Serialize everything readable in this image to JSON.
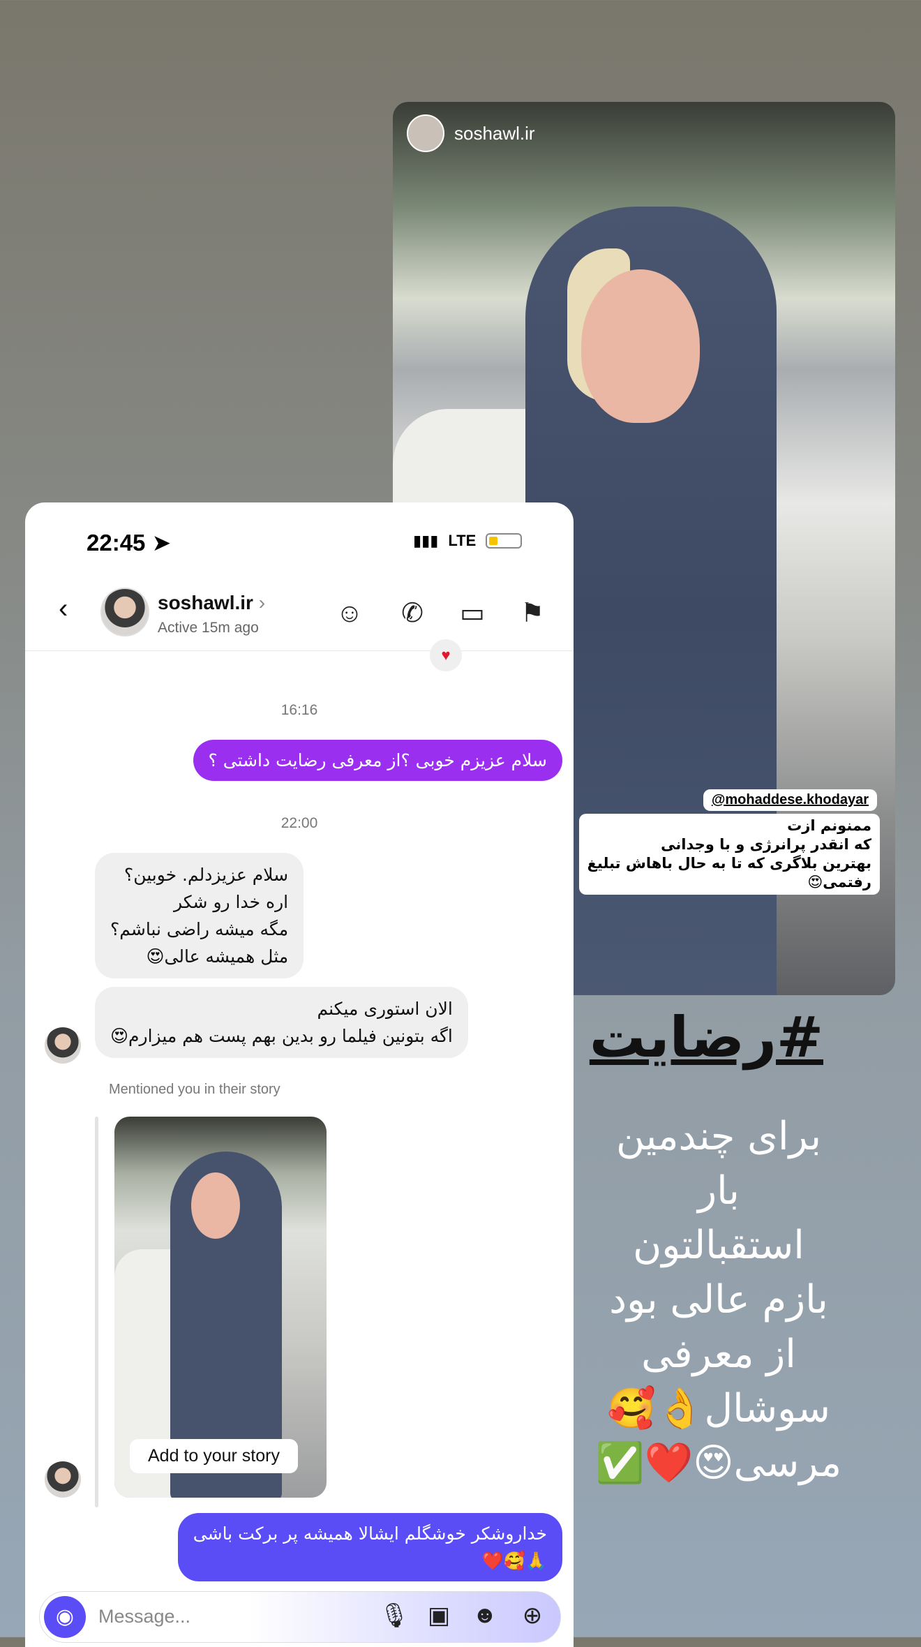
{
  "story": {
    "username": "soshawl.ir",
    "tag_handle": "@mohaddese.khodayar",
    "tag_lines": [
      "ممنونم ازت",
      "که انقدر پرانرژی و با وجدانی",
      "بهترین بلاگری که تا به حال باهاش تبلیغ",
      "رفتمی😍"
    ]
  },
  "caption": {
    "hashtag": "#رضایت",
    "lines": [
      "برای چندمین",
      "بار",
      "استقبالتون",
      "بازم عالی بود",
      "از معرفی",
      "سوشال👌🥰",
      "مرسی😍❤️✅"
    ]
  },
  "status": {
    "time": "22:45",
    "network": "LTE"
  },
  "header": {
    "name": "soshawl.ir",
    "chevron": "›",
    "subtitle": "Active 15m ago",
    "icons": [
      "effects-icon",
      "phone-icon",
      "video-icon",
      "flag-icon"
    ]
  },
  "chat": {
    "reaction": "♥",
    "time1": "16:16",
    "msg_out_1": "سلام عزیزم خوبی ؟از معرفی رضایت داشتی ؟",
    "time2": "22:00",
    "msg_in_1": [
      "سلام عزیزدلم. خوبین؟",
      "اره خدا رو شکر",
      "مگه میشه راضی نباشم؟",
      "مثل همیشه عالی😍"
    ],
    "msg_in_2": [
      "الان استوری میکنم",
      "اگه بتونین فیلما رو بدین بهم پست هم میزارم😍"
    ],
    "mention_label": "Mentioned you in their story",
    "add_story": "Add to your story",
    "msg_out_2": [
      "خداروشکر خوشگلم ایشالا همیشه پر برکت باشی",
      "🙏🥰❤️"
    ]
  },
  "input": {
    "placeholder": "Message..."
  }
}
